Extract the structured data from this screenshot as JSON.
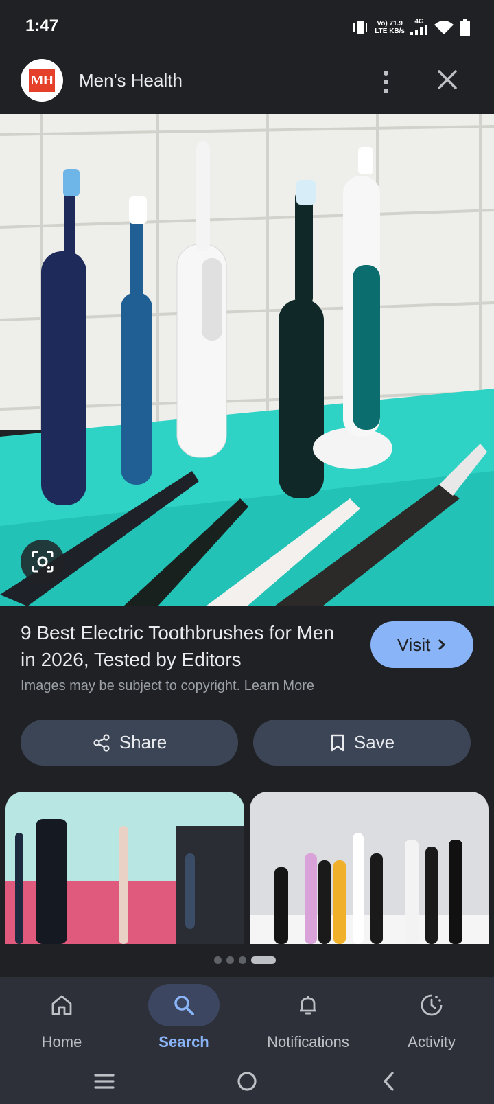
{
  "status_bar": {
    "time": "1:47",
    "net_top": "Vo) 71.9",
    "net_bottom": "LTE KB/s",
    "network_type": "4G"
  },
  "header": {
    "source_logo_text": "MH",
    "source_name": "Men's Health"
  },
  "result": {
    "title": "9 Best Electric Toothbrushes for Men in 2026, Tested by Editors",
    "visit_label": "Visit",
    "copyright": "Images may be subject to copyright. Learn More",
    "share_label": "Share",
    "save_label": "Save"
  },
  "pager": {
    "count": 4,
    "active_index": 3
  },
  "bottom_nav": {
    "items": [
      {
        "label": "Home",
        "icon": "home-icon"
      },
      {
        "label": "Search",
        "icon": "search-icon",
        "active": true
      },
      {
        "label": "Notifications",
        "icon": "bell-icon"
      },
      {
        "label": "Activity",
        "icon": "activity-icon"
      }
    ]
  },
  "colors": {
    "background": "#202124",
    "accent": "#8ab4f8",
    "button_bg": "#3c4555",
    "brand_red": "#e5412a"
  }
}
